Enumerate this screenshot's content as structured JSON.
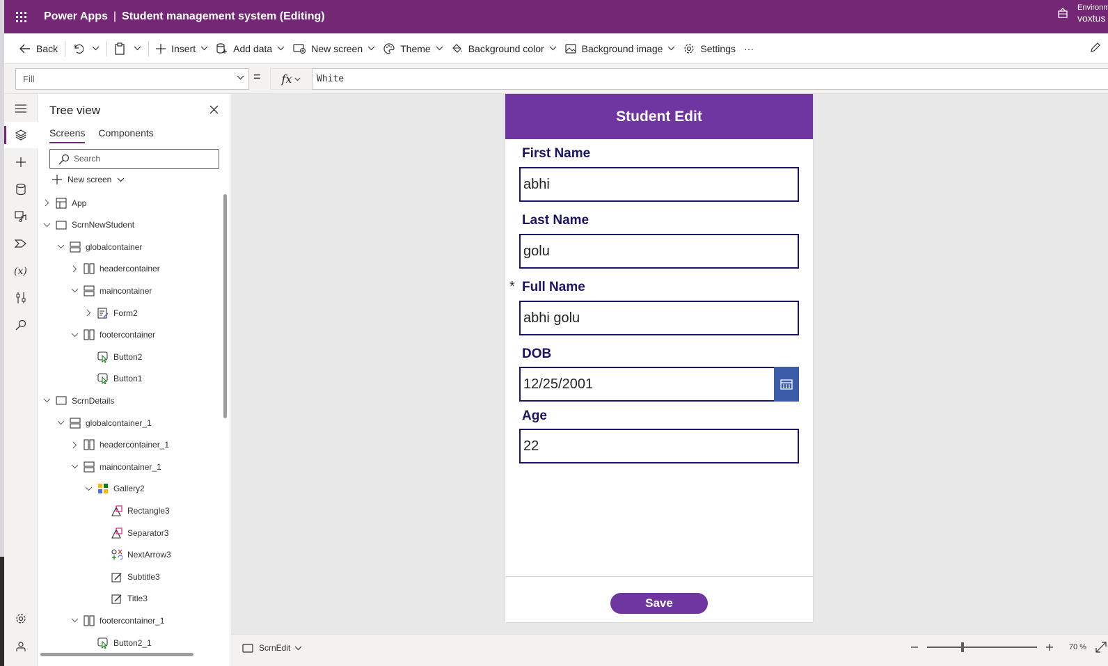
{
  "titlebar": {
    "app_name": "Power Apps",
    "separator": "|",
    "doc_title": "Student management system (Editing)",
    "env_label": "Environm",
    "env_name": "voxtus"
  },
  "commandbar": {
    "back": "Back",
    "insert": "Insert",
    "add_data": "Add data",
    "new_screen": "New screen",
    "theme": "Theme",
    "background_color": "Background color",
    "background_image": "Background image",
    "settings": "Settings",
    "more": "···"
  },
  "formulabar": {
    "property": "Fill",
    "equals": "=",
    "fx": "fx",
    "formula": "White"
  },
  "tree": {
    "title": "Tree view",
    "tabs": [
      "Screens",
      "Components"
    ],
    "search_placeholder": "Search",
    "new_screen": "New screen",
    "nodes": [
      {
        "label": "App",
        "depth": 0,
        "expand": "right",
        "icon": "app-icon"
      },
      {
        "label": "ScrnNewStudent",
        "depth": 0,
        "expand": "down",
        "icon": "screen-icon"
      },
      {
        "label": "globalcontainer",
        "depth": 1,
        "expand": "down",
        "icon": "vertical-container-icon"
      },
      {
        "label": "headercontainer",
        "depth": 2,
        "expand": "right",
        "icon": "horizontal-container-icon"
      },
      {
        "label": "maincontainer",
        "depth": 2,
        "expand": "down",
        "icon": "vertical-container-icon"
      },
      {
        "label": "Form2",
        "depth": 3,
        "expand": "right",
        "icon": "form-icon"
      },
      {
        "label": "footercontainer",
        "depth": 2,
        "expand": "down",
        "icon": "horizontal-container-icon"
      },
      {
        "label": "Button2",
        "depth": 3,
        "expand": "",
        "icon": "button-icon"
      },
      {
        "label": "Button1",
        "depth": 3,
        "expand": "",
        "icon": "button-icon"
      },
      {
        "label": "ScrnDetails",
        "depth": 0,
        "expand": "down",
        "icon": "screen-icon"
      },
      {
        "label": "globalcontainer_1",
        "depth": 1,
        "expand": "down",
        "icon": "vertical-container-icon"
      },
      {
        "label": "headercontainer_1",
        "depth": 2,
        "expand": "right",
        "icon": "horizontal-container-icon"
      },
      {
        "label": "maincontainer_1",
        "depth": 2,
        "expand": "down",
        "icon": "vertical-container-icon"
      },
      {
        "label": "Gallery2",
        "depth": 3,
        "expand": "down",
        "icon": "gallery-icon"
      },
      {
        "label": "Rectangle3",
        "depth": 4,
        "expand": "",
        "icon": "shape-icon"
      },
      {
        "label": "Separator3",
        "depth": 4,
        "expand": "",
        "icon": "shape-icon"
      },
      {
        "label": "NextArrow3",
        "depth": 4,
        "expand": "",
        "icon": "icon-control-icon"
      },
      {
        "label": "Subtitle3",
        "depth": 4,
        "expand": "",
        "icon": "label-icon"
      },
      {
        "label": "Title3",
        "depth": 4,
        "expand": "",
        "icon": "label-icon"
      },
      {
        "label": "footercontainer_1",
        "depth": 2,
        "expand": "down",
        "icon": "horizontal-container-icon"
      },
      {
        "label": "Button2_1",
        "depth": 3,
        "expand": "",
        "icon": "button-icon"
      }
    ]
  },
  "screen": {
    "header": "Student Edit",
    "fields": {
      "first_name_label": "First Name",
      "first_name_value": "abhi",
      "last_name_label": "Last Name",
      "last_name_value": "golu",
      "full_name_required": "*",
      "full_name_label": "Full Name",
      "full_name_value": "abhi golu",
      "dob_label": "DOB",
      "dob_value": "12/25/2001",
      "age_label": "Age",
      "age_value": "22"
    },
    "save_label": "Save"
  },
  "statusbar": {
    "screen_name": "ScrnEdit",
    "zoom_percent": "70 %",
    "zoom_level": 70
  },
  "colors": {
    "brand": "#742774",
    "screen_header": "#6f35a0",
    "field_border": "#1b1464",
    "calendar_button": "#3b5ca8"
  }
}
